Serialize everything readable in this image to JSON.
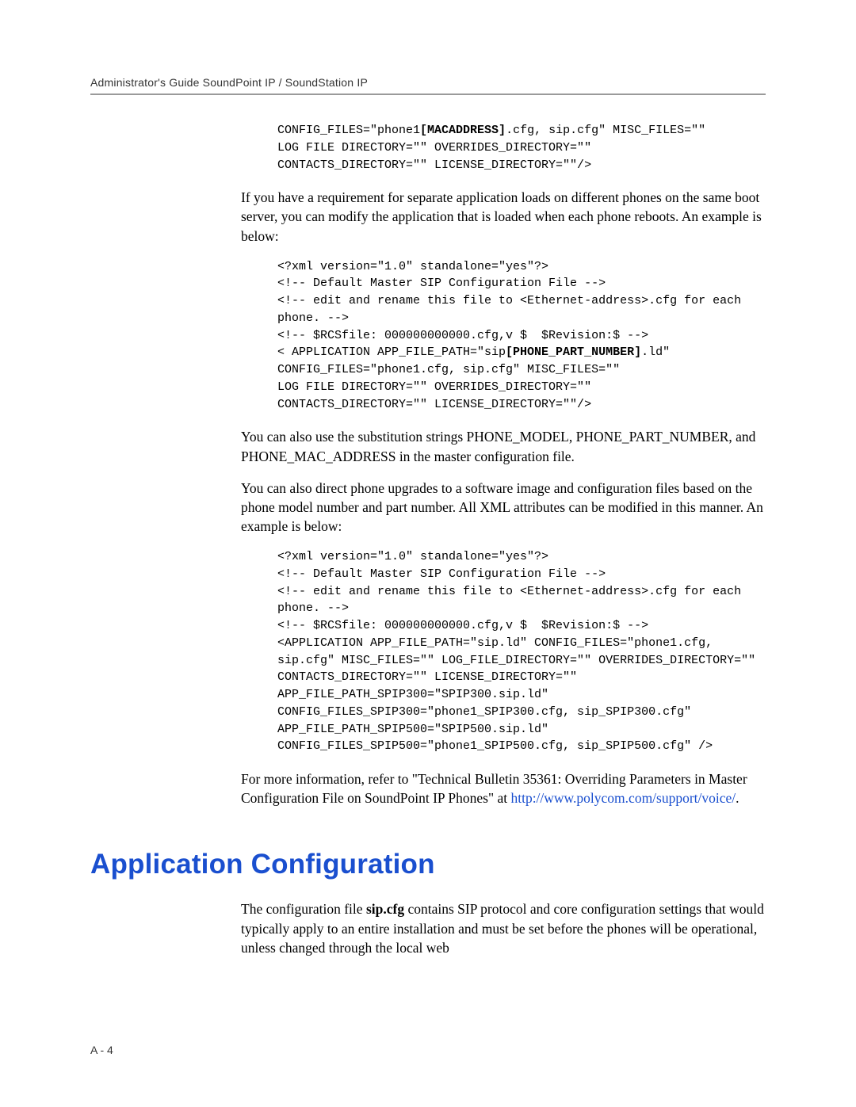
{
  "header": {
    "running": "Administrator's Guide SoundPoint IP / SoundStation IP"
  },
  "code1": {
    "l1a": "CONFIG_FILES=\"phone1",
    "l1b": "[MACADDRESS]",
    "l1c": ".cfg, sip.cfg\" MISC_FILES=\"\"",
    "l2": "LOG FILE DIRECTORY=\"\" OVERRIDES_DIRECTORY=\"\"",
    "l3": "CONTACTS_DIRECTORY=\"\" LICENSE_DIRECTORY=\"\"/>"
  },
  "para1": "If you have a requirement for separate application loads on different phones on the same boot server, you can modify the application that is loaded when each phone reboots. An example is below:",
  "code2": {
    "l1": "<?xml version=\"1.0\" standalone=\"yes\"?>",
    "l2": "<!-- Default Master SIP Configuration File -->",
    "l3": "<!-- edit and rename this file to <Ethernet-address>.cfg for each phone. -->",
    "l4": "<!-- $RCSfile: 000000000000.cfg,v $  $Revision:$ -->",
    "l5a": "< APPLICATION APP_FILE_PATH=\"sip",
    "l5b": "[PHONE_PART_NUMBER]",
    "l5c": ".ld\"",
    "l6": "CONFIG_FILES=\"phone1.cfg, sip.cfg\" MISC_FILES=\"\"",
    "l7": "LOG FILE DIRECTORY=\"\" OVERRIDES_DIRECTORY=\"\"",
    "l8": "CONTACTS_DIRECTORY=\"\" LICENSE_DIRECTORY=\"\"/>"
  },
  "para2": "You can also use the substitution strings PHONE_MODEL, PHONE_PART_NUMBER, and PHONE_MAC_ADDRESS in the master configuration file.",
  "para3": "You can also direct phone upgrades to a software image and configuration files based on the phone model number and part number. All XML attributes can be modified in this manner. An example is below:",
  "code3": {
    "l1": "<?xml version=\"1.0\" standalone=\"yes\"?>",
    "l2": "<!-- Default Master SIP Configuration File -->",
    "l3": "<!-- edit and rename this file to <Ethernet-address>.cfg for each phone. -->",
    "l4": "<!-- $RCSfile: 000000000000.cfg,v $  $Revision:$ -->",
    "l5": "<APPLICATION APP_FILE_PATH=\"sip.ld\" CONFIG_FILES=\"phone1.cfg, sip.cfg\" MISC_FILES=\"\" LOG_FILE_DIRECTORY=\"\" OVERRIDES_DIRECTORY=\"\"",
    "l6": "CONTACTS_DIRECTORY=\"\" LICENSE_DIRECTORY=\"\"",
    "l7": "APP_FILE_PATH_SPIP300=\"SPIP300.sip.ld\"",
    "l8": "CONFIG_FILES_SPIP300=\"phone1_SPIP300.cfg, sip_SPIP300.cfg\"",
    "l9": "APP_FILE_PATH_SPIP500=\"SPIP500.sip.ld\"",
    "l10": "CONFIG_FILES_SPIP500=\"phone1_SPIP500.cfg, sip_SPIP500.cfg\" />"
  },
  "para4a": "For more information, refer to \"Technical Bulletin 35361: Overriding Parameters in Master Configuration File on SoundPoint IP Phones\" at ",
  "para4_link": "http://www.polycom.com/support/voice/",
  "para4b": ".",
  "section_heading": "Application Configuration",
  "para5a": "The configuration file ",
  "para5_bold": "sip.cfg",
  "para5b": " contains SIP protocol and core configuration settings that would typically apply to an entire installation and must be set before the phones will be operational, unless changed through the local web",
  "page_number": "A - 4"
}
